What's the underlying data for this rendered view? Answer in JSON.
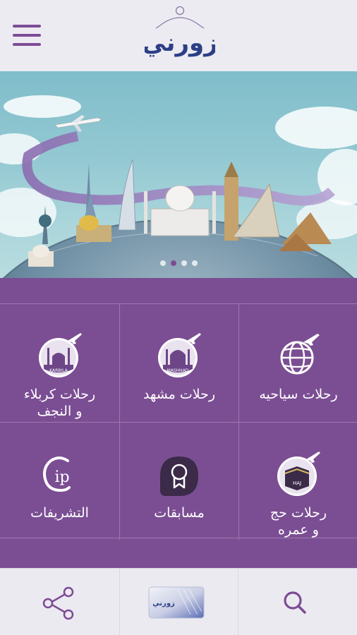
{
  "header": {
    "logo_text": "زورني",
    "menu_icon": "hamburger-menu-icon"
  },
  "banner": {
    "slides": 4,
    "active_slide": 2
  },
  "tiles": [
    {
      "label": "رحلات سياحيه",
      "icon": "globe-plane-icon"
    },
    {
      "label": "رحلات مشهد",
      "icon": "mashhad-shrine-icon",
      "badge": "MASHHAD"
    },
    {
      "label": "رحلات كربلاء\nو النجف",
      "icon": "karbala-shrine-icon",
      "badge": "KARBILA"
    },
    {
      "label": "رحلات حج\nو عمره",
      "icon": "kaaba-icon",
      "badge": "HAJ"
    },
    {
      "label": "مسابقات",
      "icon": "award-ribbon-icon"
    },
    {
      "label": "التشريفات",
      "icon": "cip-icon",
      "badge": "ip"
    }
  ],
  "bottom_nav": {
    "share_icon": "share-icon",
    "card_icon": "member-card-icon",
    "card_text": "زورني",
    "search_icon": "search-icon"
  },
  "colors": {
    "accent": "#7d4c96",
    "panel": "#7b4e93",
    "background": "#efedf4"
  }
}
